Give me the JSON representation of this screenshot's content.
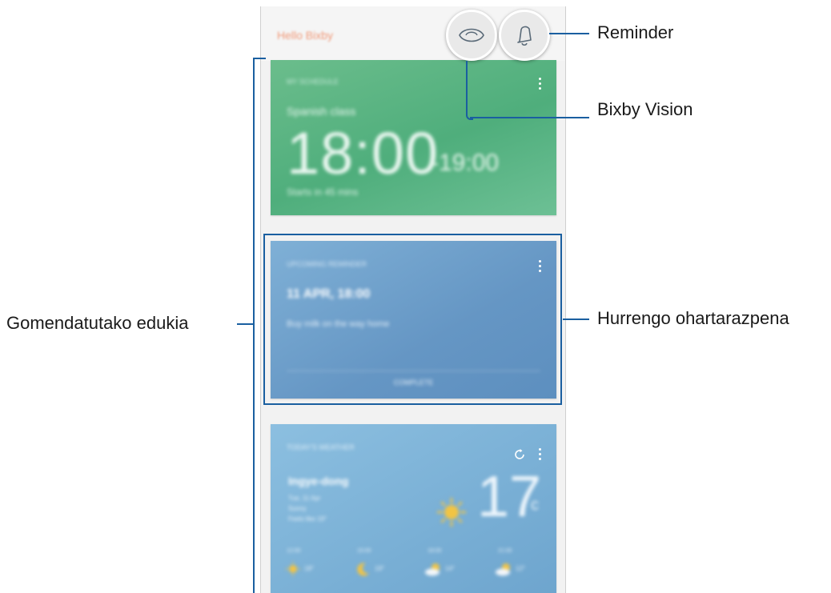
{
  "callouts": {
    "reminder": "Reminder",
    "bixby_vision": "Bixby Vision",
    "recommended": "Gomendatutako edukia",
    "next_notification": "Hurrengo ohartarazpena"
  },
  "app": {
    "title": "Hello Bixby"
  },
  "cards": {
    "event": {
      "header": "MY SCHEDULE",
      "title": "Spanish class",
      "time": "18:00",
      "end": "-19:00",
      "starts": "Starts in 45 mins"
    },
    "reminder": {
      "header": "UPCOMING REMINDER",
      "date": "11 APR, 18:00",
      "desc": "Buy milk on the way home",
      "action": "COMPLETE"
    },
    "weather": {
      "header": "TODAY'S WEATHER",
      "location": "Ingye-dong",
      "date": "Tue, 11 Apr",
      "condition": "Sunny",
      "feels": "Feels like 19°",
      "temp": "17",
      "unit": "c",
      "forecast": [
        {
          "time": "12:00",
          "temp": "18°",
          "icon": "sun-icon"
        },
        {
          "time": "15:00",
          "temp": "19°",
          "icon": "moon-icon"
        },
        {
          "time": "18:00",
          "temp": "14°",
          "icon": "partly-cloudy-icon"
        },
        {
          "time": "21:00",
          "temp": "12°",
          "icon": "partly-cloudy-icon"
        }
      ]
    }
  },
  "colors": {
    "annotation": "#1a5fa0",
    "event_card": "#5db585",
    "reminder_card": "#6f9fcb",
    "weather_card": "#7fb5da",
    "sun": "#f2c443"
  }
}
